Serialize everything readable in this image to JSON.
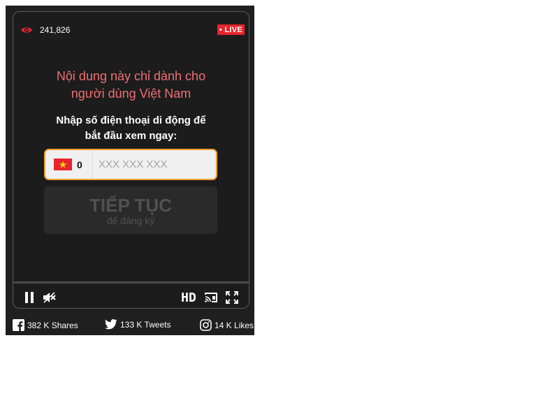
{
  "player": {
    "viewer_count": "241,826",
    "live_badge": "• LIVE",
    "headline_line1": "Nội dung này chỉ dành cho",
    "headline_line2": "người dùng Việt Nam",
    "prompt_line1": "Nhập số điện thoại di động để",
    "prompt_line2": "bắt đầu xem ngay:",
    "phone_prefix": "0",
    "phone_placeholder": "XXX XXX XXX",
    "continue_label": "TIẾP TỤC",
    "continue_sublabel": "để đăng ký",
    "quality_label": "HD",
    "icons": {
      "views": "eye-icon",
      "country": "vietnam-flag-icon",
      "pause": "pause-icon",
      "mute": "mute-icon",
      "cast": "cast-icon",
      "fullscreen": "fullscreen-icon"
    }
  },
  "social": {
    "facebook": "382 K Shares",
    "twitter": "133 K Tweets",
    "instagram": "14 K Likes"
  },
  "colors": {
    "background": "#1f1f1f",
    "accent_red": "#e8242c",
    "headline_pink": "#ef6f73",
    "input_border": "#f0a030"
  }
}
